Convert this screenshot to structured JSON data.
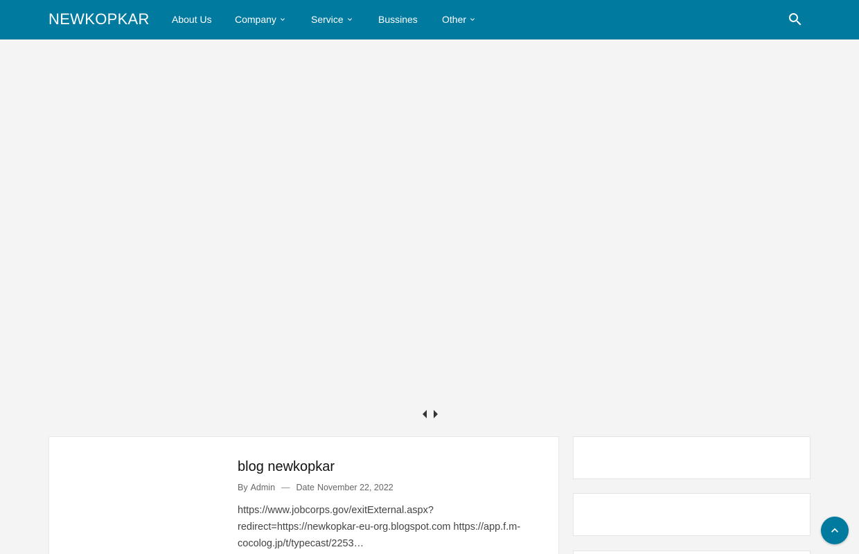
{
  "header": {
    "brand": "NEWKOPKAR",
    "nav": [
      {
        "label": "About Us",
        "dropdown": false
      },
      {
        "label": "Company",
        "dropdown": true
      },
      {
        "label": "Service",
        "dropdown": true
      },
      {
        "label": "Bussines",
        "dropdown": false
      },
      {
        "label": "Other",
        "dropdown": true
      }
    ],
    "search_icon": "search-icon"
  },
  "slider": {
    "prev_icon": "caret-left-icon",
    "next_icon": "caret-right-icon"
  },
  "post": {
    "title": "blog newkopkar",
    "by_label": "By",
    "author": "Admin",
    "date_label": "Date",
    "date": "November 22, 2022",
    "excerpt": "https://www.jobcorps.gov/exitExternal.aspx?redirect=https://newkopkar-eu-org.blogspot.com https://app.f.m-cocolog.jp/t/typecast/2253…"
  },
  "back_to_top_icon": "chevron-up-icon",
  "colors": {
    "primary": "#007a9f",
    "background": "#f4f4f4",
    "card": "#ffffff"
  }
}
